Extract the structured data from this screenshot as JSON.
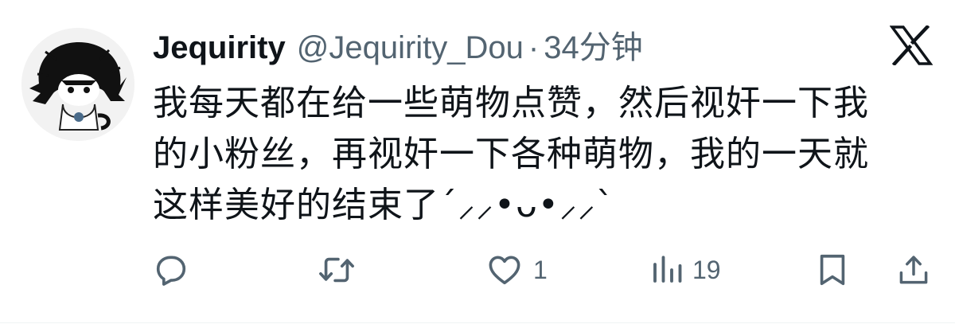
{
  "tweet": {
    "author": {
      "display_name": "Jequirity",
      "handle": "@Jequirity_Dou",
      "avatar": "avatar-image"
    },
    "separator": "·",
    "time": "34分钟",
    "platform_icon": "x-logo-icon",
    "text_lines": [
      "我每天都在给一些萌物点赞，然后视奸一下我",
      "的小粉丝，再视奸一下各种萌物，我的一天就",
      "这样美好的结束了´⸝⸝•ᴗ•⸝⸝`"
    ],
    "actions": {
      "reply": {
        "icon": "reply-icon",
        "count": ""
      },
      "retweet": {
        "icon": "retweet-icon",
        "count": ""
      },
      "like": {
        "icon": "heart-icon",
        "count": "1"
      },
      "views": {
        "icon": "views-icon",
        "count": "19"
      },
      "bookmark": {
        "icon": "bookmark-icon"
      },
      "share": {
        "icon": "share-icon"
      }
    }
  },
  "colors": {
    "text_primary": "#0f1419",
    "text_secondary": "#536471",
    "background": "#ffffff"
  }
}
